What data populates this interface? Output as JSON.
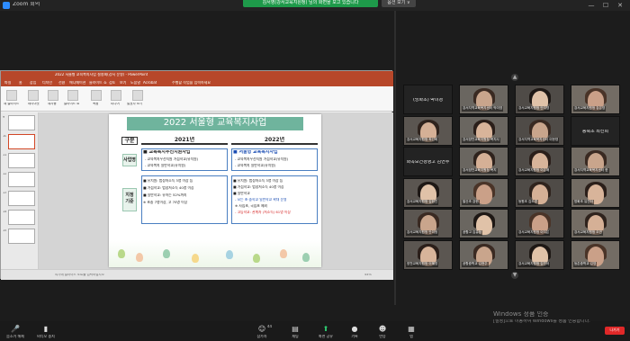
{
  "zoom": {
    "title": "Zoom 회의",
    "share_notice": "김서영(강서교육지원청) 님의 화면을 보고 있습니다",
    "view_options": "옵션 보기 ∨",
    "win_min": "—",
    "win_max": "☐",
    "win_close": "✕"
  },
  "ppt": {
    "title": "2022 서울형 교육복지사업 설명회(강서 운영) - PowerPoint",
    "tabs": [
      "파일",
      "홈",
      "삽입",
      "디자인",
      "전환",
      "애니메이션",
      "슬라이드 쇼",
      "검토",
      "보기",
      "도움말",
      "Acrobat"
    ],
    "ribbon_groups": [
      "새 슬라이드",
      "레이아웃",
      "재사용",
      "슬라이드 쇼",
      "녹음",
      "미디어",
      "발표자 보기"
    ],
    "search_hint": "수행할 작업을 입력하세요",
    "thumb_numbers": [
      "9",
      "10",
      "11",
      "12",
      "13",
      "14",
      "15"
    ],
    "status": "여기에 슬라이드 노트를 입력하십시오",
    "zoom_level": "44%"
  },
  "slide": {
    "title": "2022 서울형 교육복지사업",
    "col_label": "구분",
    "col_2021": "2021년",
    "col_2022": "2022년",
    "row1_label": "사업명",
    "row2_label": "지정 기준",
    "r1_2021": [
      "■ 교육복지우선지원사업",
      "- 교육복지우선지원 거점학교(유치원)",
      "- 교육복지 일반학교(유치원)"
    ],
    "r1_2022": [
      "■ 서울형 교육복지사업",
      "- 교육복지우선지원 거점학교(유치원)",
      "- 교육복지 일반학교(유치원)"
    ],
    "r2_2021": [
      "■ 유치원: 법정저소득 3명 이상 등",
      "■ 거점학교: 법정저소득 40명 이상",
      "■ 일반학교: 유아는 52%까지",
      "※ 초중 7명이상, 고 70명 이상"
    ],
    "r2_2022": [
      "■ 유치원: 법정저소득 3명 이상 등",
      "■ 거점학교: 법정저소득 40명 이상",
      "■ 일반학교",
      "- 모든 초·중학교 일반학교 확대 운영",
      "※ 사립초, 국립초 제외",
      "- 고등학교: 관계자 (저소득) 61명 이상"
    ]
  },
  "participants": [
    {
      "name": "(방화초) 박미경",
      "video": false
    },
    {
      "name": "강서지역교육복지센터 박미영",
      "video": true
    },
    {
      "name": "강서교육지원청 안지영",
      "video": true
    },
    {
      "name": "강서교육지원청 강은영",
      "video": true
    },
    {
      "name": "강서교육지원청 최선희",
      "video": true
    },
    {
      "name": "강서양천교육지원청 복지사",
      "video": true
    },
    {
      "name": "강서지역교육복지센터 이현영",
      "video": true
    },
    {
      "name": "등축초 최선희",
      "video": false
    },
    {
      "name": "화곡보건경영고 김연주",
      "video": false
    },
    {
      "name": "강서양천교육지원청 복지",
      "video": true
    },
    {
      "name": "강서교육지원청 이은애",
      "video": true
    },
    {
      "name": "강서지역교육복지센터 한",
      "video": true
    },
    {
      "name": "강서교육지원청 김현진",
      "video": true
    },
    {
      "name": "발산초 강현",
      "video": true
    },
    {
      "name": "등원초 김도경",
      "video": true
    },
    {
      "name": "방화초 유진아",
      "video": true
    },
    {
      "name": "강서교육지원청 안미정",
      "video": true
    },
    {
      "name": "공항고 김유정",
      "video": true
    },
    {
      "name": "강서교육지원청 이지은",
      "video": true
    },
    {
      "name": "강서교육지원청 오연",
      "video": true
    },
    {
      "name": "양천교육지원청 이혜영",
      "video": true
    },
    {
      "name": "공항중학교 김현주",
      "video": true
    },
    {
      "name": "강서교육지원청 김민아",
      "video": true
    },
    {
      "name": "등촌중학교 김영",
      "video": true
    }
  ],
  "page_nav": {
    "up": "▲",
    "down": "▼"
  },
  "controls": {
    "mute": "음소거 해제",
    "video": "비디오 중지",
    "participants": "참가자",
    "participant_count": "44",
    "chat": "채팅",
    "share": "화면 공유",
    "record": "기록",
    "reactions": "반응",
    "apps": "앱",
    "end": "나가기"
  },
  "windows": {
    "line1": "Windows 정품 인증",
    "line2": "[설정]으로 이동하여 Windows를 정품 인증합니다."
  }
}
